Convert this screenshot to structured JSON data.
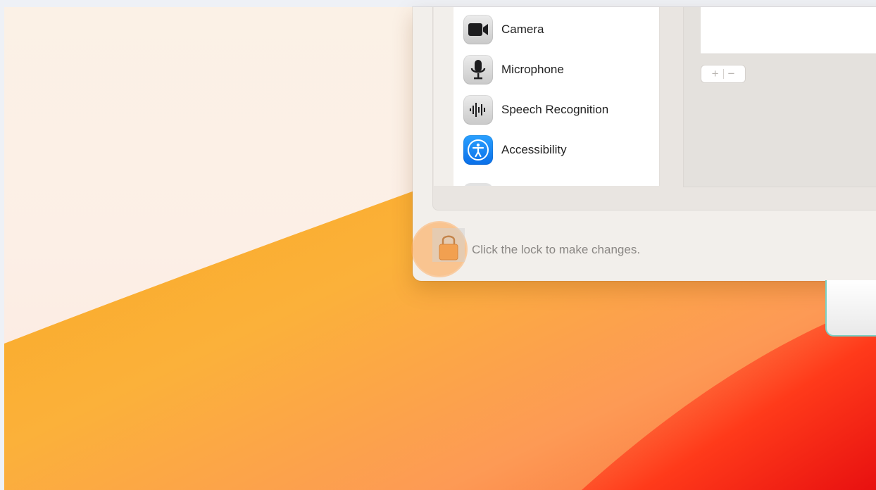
{
  "privacy_list": {
    "items": [
      {
        "label": "Camera",
        "icon": "camera-icon"
      },
      {
        "label": "Microphone",
        "icon": "microphone-icon"
      },
      {
        "label": "Speech Recognition",
        "icon": "speech-recognition-icon"
      },
      {
        "label": "Accessibility",
        "icon": "accessibility-icon"
      }
    ]
  },
  "controls": {
    "add_label": "+",
    "remove_label": "−"
  },
  "footer": {
    "lock_message": "Click the lock to make changes."
  },
  "colors": {
    "lock": "#f2a050",
    "accessibility_blue": "#0a6fe8",
    "wallpaper_orange": "#fbb13a",
    "wallpaper_red": "#ff3a1a"
  }
}
